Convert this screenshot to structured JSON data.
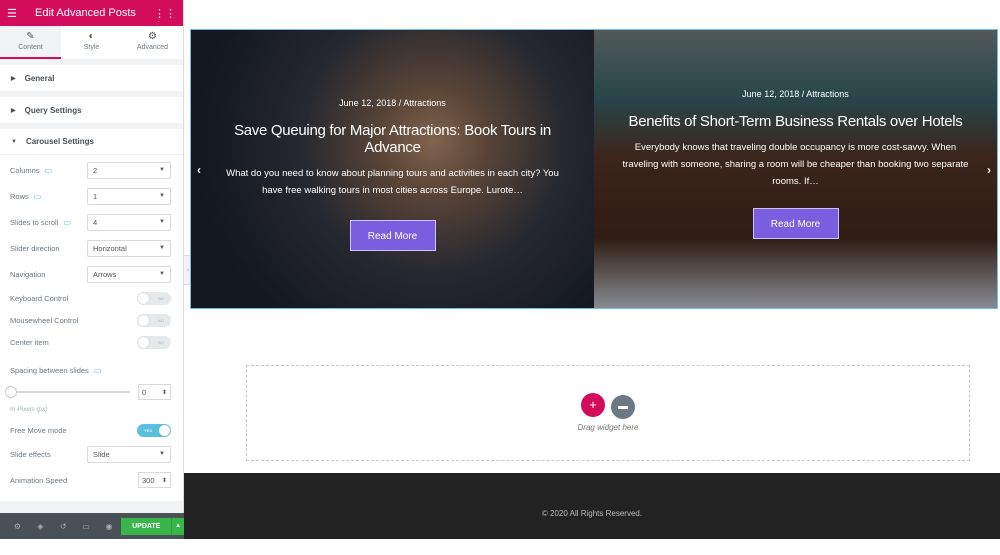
{
  "panel": {
    "title": "Edit Advanced Posts",
    "tabs": [
      {
        "label": "Content",
        "icon": "pencil-icon"
      },
      {
        "label": "Style",
        "icon": "contrast-icon"
      },
      {
        "label": "Advanced",
        "icon": "gear-icon"
      }
    ],
    "sections": {
      "general": "General",
      "query": "Query Settings",
      "carousel": "Carousel Settings"
    },
    "fields": {
      "columns": {
        "label": "Columns",
        "value": "2"
      },
      "rows": {
        "label": "Rows",
        "value": "1"
      },
      "slides_to_scroll": {
        "label": "Slides to scroll",
        "value": "4"
      },
      "slider_direction": {
        "label": "Slider direction",
        "value": "Horizontal"
      },
      "navigation": {
        "label": "Navigation",
        "value": "Arrows"
      },
      "keyboard": {
        "label": "Keyboard Control",
        "state": "NO"
      },
      "mousewheel": {
        "label": "Mousewheel Control",
        "state": "NO"
      },
      "center": {
        "label": "Center item",
        "state": "NO"
      },
      "spacing": {
        "label": "Spacing between slides",
        "value": "0",
        "slider_value": 0,
        "hint": "In Pixels (px)"
      },
      "free_move": {
        "label": "Free Move mode",
        "state": "YES"
      },
      "slide_effects": {
        "label": "Slide effects",
        "value": "Slide"
      },
      "animation_speed": {
        "label": "Animation Speed",
        "value": "300"
      }
    },
    "update_label": "UPDATE"
  },
  "slides": [
    {
      "date": "June 12, 2018",
      "sep": "/",
      "category": "Attractions",
      "title": "Save Queuing for Major Attractions: Book Tours in Advance",
      "excerpt": "What do you need to know about planning tours and activities in each city? You have free walking tours in most cities across Europe. Lurote…",
      "button": "Read More"
    },
    {
      "date": "June 12, 2018",
      "sep": "/",
      "category": "Attractions",
      "title": "Benefits of Short-Term Business Rentals over Hotels",
      "excerpt": "Everybody knows that traveling double occupancy is more cost-savvy. When traveling with someone, sharing a room will be cheaper than booking two separate rooms. If…",
      "button": "Read More"
    }
  ],
  "dropzone": {
    "text": "Drag widget here"
  },
  "footer": {
    "text": "© 2020 All Rights Reserved."
  },
  "colors": {
    "brand": "#d30c5c",
    "button": "#7a5ee0",
    "update": "#39b54a"
  }
}
